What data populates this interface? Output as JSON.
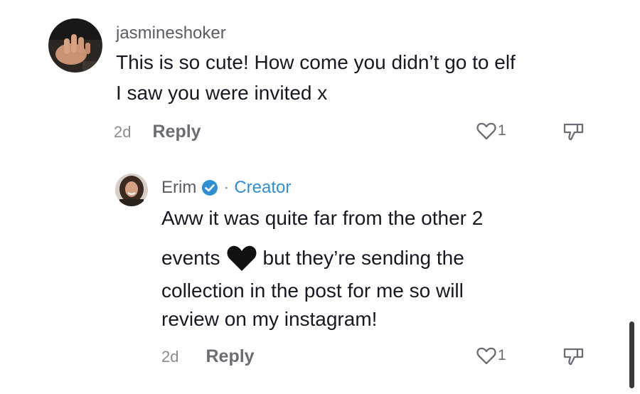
{
  "comments": [
    {
      "username": "jasmineshoker",
      "text_lines": [
        "This is so cute! How come you didn’t go to elf",
        "I saw you were invited x"
      ],
      "time": "2d",
      "reply_label": "Reply",
      "like_count": "1"
    },
    {
      "username": "Erim",
      "separator": "·",
      "badge_label": "Creator",
      "text_lines": [
        "Aww it was quite far from the other 2",
        "events",
        "but they’re sending the",
        "collection in the post for me so will",
        "review on my instagram!"
      ],
      "time": "2d",
      "reply_label": "Reply",
      "like_count": "1"
    }
  ],
  "colors": {
    "accent": "#2f8fd1",
    "text": "#161823",
    "muted": "#6b6d75"
  },
  "icons": [
    "heart-outline-icon",
    "dislike-icon",
    "verified-icon",
    "black-heart-emoji"
  ]
}
